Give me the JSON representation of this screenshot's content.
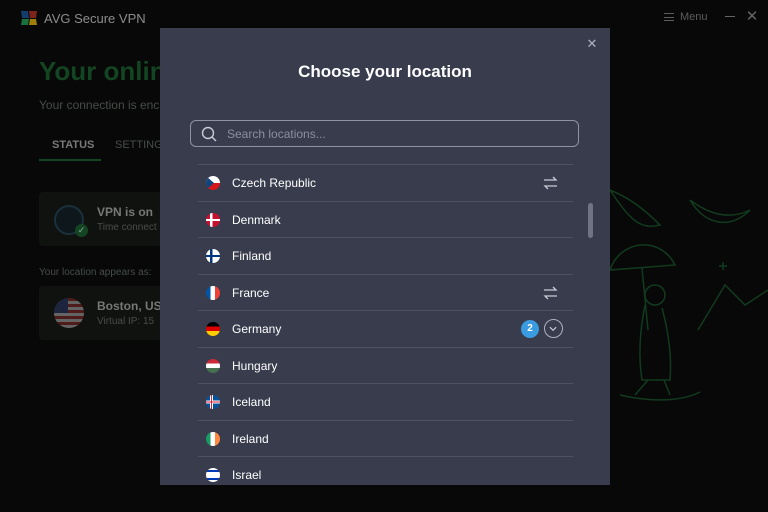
{
  "app": {
    "title": "AVG Secure VPN",
    "menu_label": "Menu"
  },
  "background": {
    "headline": "Your online",
    "subtitle": "Your connection is enc",
    "tabs": [
      {
        "label": "STATUS",
        "active": true
      },
      {
        "label": "SETTINGS",
        "active": false
      }
    ],
    "vpn_card": {
      "title": "VPN is on",
      "subtitle": "Time connect"
    },
    "location_label": "Your location appears as:",
    "location_card": {
      "title": "Boston, USA",
      "subtitle": "Virtual IP: 15"
    }
  },
  "modal": {
    "title": "Choose your location",
    "search": {
      "placeholder": "Search locations...",
      "value": ""
    },
    "countries": [
      {
        "name": "Czech Republic",
        "flag": "cz-flag-icon",
        "action": "swap"
      },
      {
        "name": "Denmark",
        "flag": "dk-flag-icon",
        "action": null
      },
      {
        "name": "Finland",
        "flag": "fi-flag-icon",
        "action": null
      },
      {
        "name": "France",
        "flag": "fr-flag-icon",
        "action": "swap"
      },
      {
        "name": "Germany",
        "flag": "de-flag-icon",
        "action": "expand",
        "count": "2"
      },
      {
        "name": "Hungary",
        "flag": "hu-flag-icon",
        "action": null
      },
      {
        "name": "Iceland",
        "flag": "is-flag-icon",
        "action": null
      },
      {
        "name": "Ireland",
        "flag": "ie-flag-icon",
        "action": null
      },
      {
        "name": "Israel",
        "flag": "il-flag-icon",
        "action": null
      }
    ]
  },
  "colors": {
    "modal_bg": "#383c4c",
    "accent_green": "#1f6b35",
    "badge_blue": "#3b9be0",
    "divider": "#4d5263"
  }
}
